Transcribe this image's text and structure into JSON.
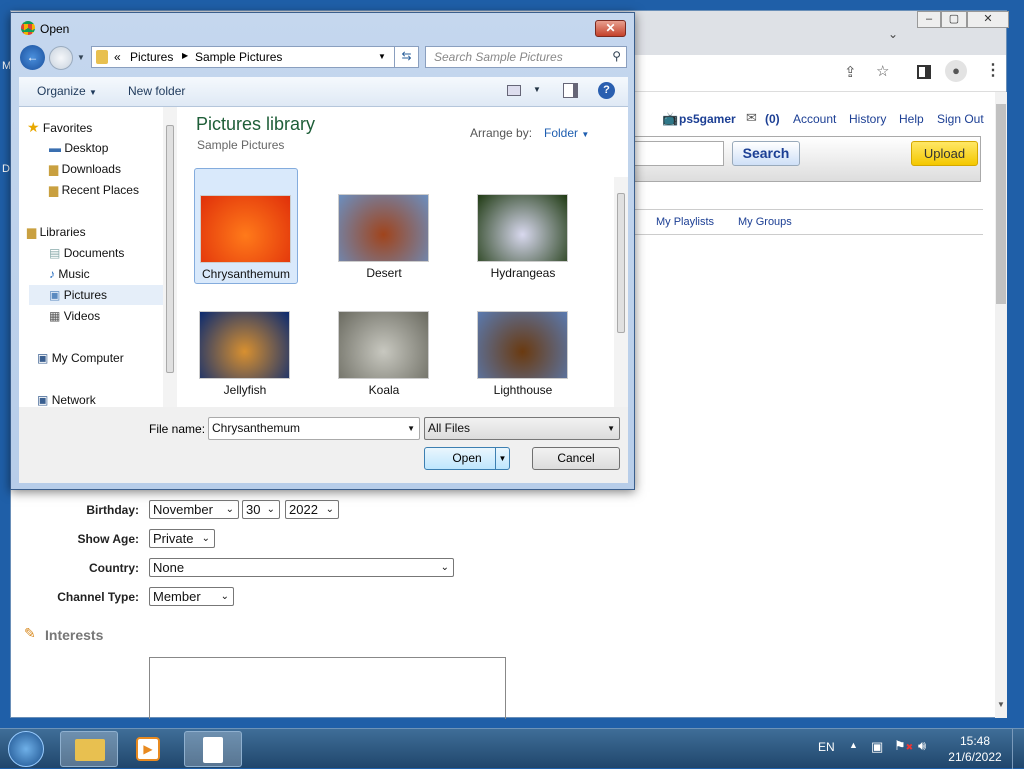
{
  "desktop": {
    "icon_letters": [
      "M",
      "D"
    ]
  },
  "browser": {
    "userbar": {
      "username": "ps5gamer",
      "messages": "(0)",
      "links": [
        "Account",
        "History",
        "Help",
        "Sign Out"
      ]
    },
    "search_button": "Search",
    "upload_button": "Upload",
    "nav_links": [
      "My Playlists",
      "My Groups"
    ],
    "form": {
      "birthday_label": "Birthday:",
      "birthday_month": "November",
      "birthday_day": "30",
      "birthday_year": "2022",
      "show_age_label": "Show Age:",
      "show_age": "Private",
      "country_label": "Country:",
      "country": "None",
      "channel_type_label": "Channel Type:",
      "channel_type": "Member",
      "interests_heading": "Interests"
    }
  },
  "dialog": {
    "title": "Open",
    "breadcrumb": [
      "Pictures",
      "Sample Pictures"
    ],
    "search_placeholder": "Search Sample Pictures",
    "toolbar": {
      "organize": "Organize",
      "new_folder": "New folder"
    },
    "nav": {
      "favorites": "Favorites",
      "favorites_items": [
        "Desktop",
        "Downloads",
        "Recent Places"
      ],
      "libraries": "Libraries",
      "library_items": [
        "Documents",
        "Music",
        "Pictures",
        "Videos"
      ],
      "computer": "My Computer",
      "network": "Network"
    },
    "library_title": "Pictures library",
    "library_subtitle": "Sample Pictures",
    "arrange_label": "Arrange by:",
    "arrange_value": "Folder",
    "files": [
      {
        "name": "Chrysanthemum",
        "colors": [
          "#e0300a",
          "#ff7a1a"
        ]
      },
      {
        "name": "Desert",
        "colors": [
          "#6b8fc0",
          "#a0441c"
        ]
      },
      {
        "name": "Hydrangeas",
        "colors": [
          "#1f3a12",
          "#d8d8ee"
        ]
      },
      {
        "name": "Jellyfish",
        "colors": [
          "#0a2a70",
          "#d89030"
        ]
      },
      {
        "name": "Koala",
        "colors": [
          "#6a6a60",
          "#c8c8c0"
        ]
      },
      {
        "name": "Lighthouse",
        "colors": [
          "#5a7ab0",
          "#6a3a10"
        ]
      }
    ],
    "selected_file": "Chrysanthemum",
    "filename_label": "File name:",
    "filename_value": "Chrysanthemum",
    "filetype": "All Files",
    "open_button": "Open",
    "cancel_button": "Cancel"
  },
  "taskbar": {
    "language": "EN",
    "time": "15:48",
    "date": "21/6/2022"
  }
}
